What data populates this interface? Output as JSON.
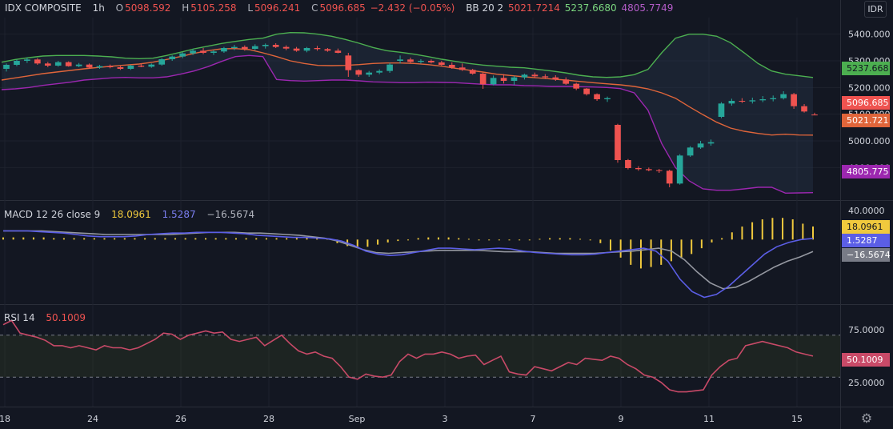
{
  "header": {
    "symbol": "IDX COMPOSITE",
    "interval": "1h",
    "o_label": "O",
    "o_value": "5098.592",
    "h_label": "H",
    "h_value": "5105.258",
    "l_label": "L",
    "l_value": "5096.241",
    "c_label": "C",
    "c_value": "5096.685",
    "change": "−2.432 (−0.05%)",
    "bb_label": "BB 20 2",
    "bb_basis": "5021.7214",
    "bb_upper": "5237.6680",
    "bb_lower": "4805.7749",
    "currency": "IDR"
  },
  "macd_legend": {
    "label": "MACD 12 26 close 9",
    "histogram": "18.0961",
    "macd": "1.5287",
    "signal": "−16.5674"
  },
  "rsi_legend": {
    "label": "RSI 14",
    "value": "50.1009"
  },
  "colors": {
    "background": "#131722",
    "up": "#26a69a",
    "down": "#ef5350",
    "bb_upper": "#4caf50",
    "bb_basis": "#e0653a",
    "bb_lower": "#9c27b0",
    "macd": "#5b5ee6",
    "signal": "#9598a1",
    "histogram": "#f0c93d",
    "rsi": "#c94a68"
  },
  "chart_data": [
    {
      "type": "candlestick",
      "title": "IDX COMPOSITE",
      "x_tick_labels": [
        "18",
        "24",
        "26",
        "28",
        "Sep",
        "3",
        "7",
        "9",
        "11",
        "15"
      ],
      "y_tick_labels": [
        "5400.000",
        "5300.000",
        "5200.000",
        "5100.000",
        "5000.000",
        "4900.000"
      ],
      "y_ticks": [
        5400,
        5300,
        5200,
        5100,
        5000,
        4900
      ],
      "ylim": [
        4790,
        5450
      ],
      "price_tags": {
        "bb_upper": "5237.668",
        "last": "5096.685",
        "bb_basis": "5021.721",
        "bb_lower": "4805.775"
      },
      "candles": [
        [
          5270,
          5290,
          5260,
          5285
        ],
        [
          5285,
          5305,
          5280,
          5300
        ],
        [
          5300,
          5312,
          5292,
          5305
        ],
        [
          5305,
          5310,
          5285,
          5290
        ],
        [
          5290,
          5296,
          5276,
          5282
        ],
        [
          5282,
          5300,
          5278,
          5295
        ],
        [
          5295,
          5298,
          5278,
          5280
        ],
        [
          5280,
          5292,
          5276,
          5286
        ],
        [
          5286,
          5290,
          5270,
          5275
        ],
        [
          5275,
          5285,
          5270,
          5280
        ],
        [
          5280,
          5286,
          5272,
          5276
        ],
        [
          5276,
          5280,
          5266,
          5270
        ],
        [
          5270,
          5285,
          5266,
          5282
        ],
        [
          5282,
          5290,
          5276,
          5278
        ],
        [
          5278,
          5290,
          5274,
          5286
        ],
        [
          5286,
          5310,
          5282,
          5306
        ],
        [
          5306,
          5320,
          5300,
          5316
        ],
        [
          5316,
          5332,
          5310,
          5328
        ],
        [
          5328,
          5345,
          5322,
          5338
        ],
        [
          5338,
          5348,
          5325,
          5330
        ],
        [
          5330,
          5340,
          5322,
          5335
        ],
        [
          5335,
          5352,
          5330,
          5348
        ],
        [
          5348,
          5360,
          5340,
          5352
        ],
        [
          5352,
          5358,
          5338,
          5345
        ],
        [
          5345,
          5362,
          5340,
          5355
        ],
        [
          5355,
          5365,
          5346,
          5360
        ],
        [
          5360,
          5366,
          5348,
          5352
        ],
        [
          5352,
          5358,
          5340,
          5346
        ],
        [
          5346,
          5352,
          5334,
          5338
        ],
        [
          5338,
          5352,
          5332,
          5348
        ],
        [
          5348,
          5356,
          5338,
          5344
        ],
        [
          5344,
          5348,
          5334,
          5338
        ],
        [
          5338,
          5346,
          5328,
          5330
        ],
        [
          5320,
          5330,
          5240,
          5265
        ],
        [
          5265,
          5268,
          5240,
          5248
        ],
        [
          5248,
          5262,
          5240,
          5256
        ],
        [
          5256,
          5268,
          5250,
          5262
        ],
        [
          5262,
          5292,
          5255,
          5286
        ],
        [
          5300,
          5320,
          5290,
          5305
        ],
        [
          5305,
          5312,
          5292,
          5296
        ],
        [
          5296,
          5306,
          5290,
          5300
        ],
        [
          5300,
          5305,
          5290,
          5294
        ],
        [
          5294,
          5300,
          5280,
          5285
        ],
        [
          5285,
          5294,
          5270,
          5275
        ],
        [
          5275,
          5290,
          5262,
          5266
        ],
        [
          5266,
          5270,
          5248,
          5252
        ],
        [
          5252,
          5256,
          5195,
          5212
        ],
        [
          5212,
          5245,
          5208,
          5236
        ],
        [
          5236,
          5250,
          5215,
          5225
        ],
        [
          5225,
          5244,
          5210,
          5238
        ],
        [
          5238,
          5252,
          5230,
          5248
        ],
        [
          5248,
          5256,
          5235,
          5242
        ],
        [
          5242,
          5250,
          5232,
          5238
        ],
        [
          5238,
          5246,
          5225,
          5230
        ],
        [
          5230,
          5238,
          5210,
          5214
        ],
        [
          5214,
          5218,
          5190,
          5196
        ],
        [
          5196,
          5198,
          5170,
          5175
        ],
        [
          5175,
          5178,
          5150,
          5156
        ],
        [
          5156,
          5166,
          5146,
          5160
        ],
        [
          5060,
          5064,
          4918,
          4928
        ],
        [
          4928,
          4932,
          4893,
          4898
        ],
        [
          4898,
          4905,
          4888,
          4894
        ],
        [
          4894,
          4900,
          4886,
          4890
        ],
        [
          4890,
          4895,
          4880,
          4888
        ],
        [
          4888,
          4892,
          4826,
          4840
        ],
        [
          4840,
          4950,
          4836,
          4945
        ],
        [
          4945,
          4980,
          4940,
          4975
        ],
        [
          4975,
          5000,
          4970,
          4990
        ],
        [
          4990,
          5005,
          4982,
          4995
        ],
        [
          5090,
          5145,
          5085,
          5140
        ],
        [
          5140,
          5158,
          5132,
          5150
        ],
        [
          5150,
          5160,
          5142,
          5148
        ],
        [
          5148,
          5162,
          5140,
          5152
        ],
        [
          5152,
          5168,
          5145,
          5156
        ],
        [
          5156,
          5170,
          5148,
          5160
        ],
        [
          5160,
          5186,
          5155,
          5175
        ],
        [
          5175,
          5180,
          5120,
          5130
        ],
        [
          5130,
          5138,
          5106,
          5110
        ],
        [
          5098.592,
          5105.258,
          5096.241,
          5096.685
        ]
      ],
      "bb_upper": [
        5295,
        5305,
        5312,
        5318,
        5320,
        5320,
        5320,
        5318,
        5315,
        5310,
        5308,
        5310,
        5320,
        5332,
        5345,
        5355,
        5365,
        5373,
        5380,
        5385,
        5400,
        5406,
        5405,
        5400,
        5392,
        5380,
        5366,
        5350,
        5338,
        5332,
        5325,
        5316,
        5306,
        5298,
        5290,
        5284,
        5280,
        5276,
        5274,
        5268,
        5262,
        5255,
        5246,
        5240,
        5238,
        5240,
        5248,
        5268,
        5330,
        5385,
        5400,
        5400,
        5392,
        5368,
        5330,
        5290,
        5262,
        5250,
        5244,
        5237.668
      ],
      "bb_basis": [
        5228,
        5236,
        5244,
        5252,
        5258,
        5264,
        5270,
        5275,
        5280,
        5284,
        5288,
        5295,
        5305,
        5316,
        5328,
        5338,
        5345,
        5346,
        5342,
        5330,
        5316,
        5300,
        5290,
        5283,
        5282,
        5283,
        5286,
        5290,
        5292,
        5292,
        5290,
        5286,
        5280,
        5272,
        5265,
        5258,
        5250,
        5245,
        5240,
        5236,
        5232,
        5228,
        5223,
        5218,
        5214,
        5210,
        5204,
        5195,
        5180,
        5160,
        5128,
        5098,
        5070,
        5048,
        5036,
        5028,
        5022,
        5025,
        5022,
        5021.721
      ],
      "bb_lower": [
        5192,
        5195,
        5200,
        5208,
        5214,
        5220,
        5228,
        5232,
        5236,
        5238,
        5236,
        5236,
        5240,
        5250,
        5262,
        5278,
        5298,
        5316,
        5320,
        5316,
        5230,
        5226,
        5224,
        5226,
        5228,
        5228,
        5225,
        5221,
        5220,
        5218,
        5218,
        5220,
        5219,
        5218,
        5215,
        5212,
        5210,
        5210,
        5207,
        5206,
        5204,
        5204,
        5203,
        5202,
        5200,
        5196,
        5180,
        5115,
        4990,
        4900,
        4850,
        4820,
        4815,
        4815,
        4820,
        4826,
        4826,
        4804,
        4805,
        4805.775
      ],
      "bb_x_start": 0,
      "bb_x_end": 79
    },
    {
      "type": "bar+line",
      "title": "MACD 12 26 close 9",
      "y_tick_labels": [
        "40.0000",
        "0.0000"
      ],
      "y_ticks": [
        40,
        0
      ],
      "ylim": [
        -85,
        48
      ],
      "price_tags": {
        "histogram": "18.0961",
        "macd": "1.5287",
        "signal": "−16.5674"
      },
      "histogram": [
        3,
        3,
        3,
        3,
        3,
        2,
        2,
        2,
        2,
        2,
        2,
        2,
        2,
        2,
        2,
        2,
        2,
        2,
        2,
        2,
        2,
        2,
        2,
        2,
        2,
        2,
        2,
        2,
        2,
        2,
        2,
        2,
        1,
        -5,
        -9,
        -11,
        -10,
        -7,
        -4,
        -2,
        0,
        2,
        3,
        3,
        3,
        2,
        1,
        0,
        -1,
        -1,
        -1,
        -1,
        0,
        1,
        2,
        2,
        2,
        1,
        0,
        -5,
        -15,
        -25,
        -35,
        -40,
        -38,
        -35,
        -30,
        -26,
        -20,
        -12,
        -4,
        2,
        10,
        18,
        24,
        28,
        30,
        30,
        28,
        22,
        18.0961
      ],
      "macd": [
        12,
        12,
        12,
        11,
        10,
        9,
        7,
        5,
        4,
        4,
        4,
        5,
        7,
        8,
        9,
        9,
        10,
        10,
        10,
        9,
        8,
        6,
        5,
        4,
        3,
        3,
        2,
        1,
        -2,
        -8,
        -16,
        -20,
        -22,
        -21,
        -18,
        -15,
        -12,
        -12,
        -13,
        -14,
        -13,
        -12,
        -13,
        -16,
        -18,
        -19,
        -20,
        -21,
        -21,
        -20,
        -18,
        -16,
        -14,
        -12,
        -16,
        -30,
        -55,
        -72,
        -80,
        -76,
        -65,
        -50,
        -35,
        -20,
        -10,
        -4,
        0,
        1.5287
      ],
      "signal": [
        12,
        12,
        12,
        12,
        11,
        10,
        9,
        8,
        7,
        7,
        7,
        7,
        7,
        7,
        8,
        9,
        10,
        10,
        10,
        9,
        9,
        8,
        7,
        6,
        4,
        2,
        -2,
        -8,
        -14,
        -18,
        -19,
        -18,
        -17,
        -16,
        -15,
        -15,
        -15,
        -15,
        -16,
        -17,
        -17,
        -17,
        -18,
        -19,
        -19,
        -19,
        -19,
        -18,
        -17,
        -16,
        -14,
        -12,
        -16,
        -28,
        -45,
        -60,
        -68,
        -66,
        -58,
        -48,
        -38,
        -30,
        -24,
        -16.5674
      ],
      "x_start": 0,
      "x_end": 80
    },
    {
      "type": "line",
      "title": "RSI 14",
      "y_tick_labels": [
        "75.0000",
        "25.0000"
      ],
      "y_ticks": [
        75,
        25
      ],
      "band": [
        70,
        30
      ],
      "ylim": [
        5,
        95
      ],
      "price_tags": {
        "rsi": "50.1009"
      },
      "rsi": [
        80,
        84,
        72,
        70,
        68,
        65,
        60,
        60,
        58,
        60,
        58,
        56,
        60,
        58,
        58,
        56,
        58,
        62,
        66,
        72,
        71,
        66,
        70,
        72,
        74,
        72,
        73,
        66,
        64,
        66,
        68,
        60,
        65,
        70,
        62,
        55,
        52,
        54,
        50,
        48,
        40,
        30,
        28,
        33,
        31,
        30,
        32,
        45,
        52,
        48,
        52,
        52,
        54,
        52,
        48,
        50,
        51,
        42,
        46,
        50,
        35,
        33,
        32,
        40,
        38,
        36,
        40,
        44,
        42,
        48,
        47,
        46,
        50,
        48,
        42,
        38,
        32,
        30,
        25,
        18,
        16,
        16,
        17,
        18,
        32,
        40,
        46,
        48,
        60,
        62,
        64,
        62,
        60,
        58,
        54,
        52,
        50.1009
      ],
      "x_start": 0,
      "x_end": 80
    }
  ]
}
